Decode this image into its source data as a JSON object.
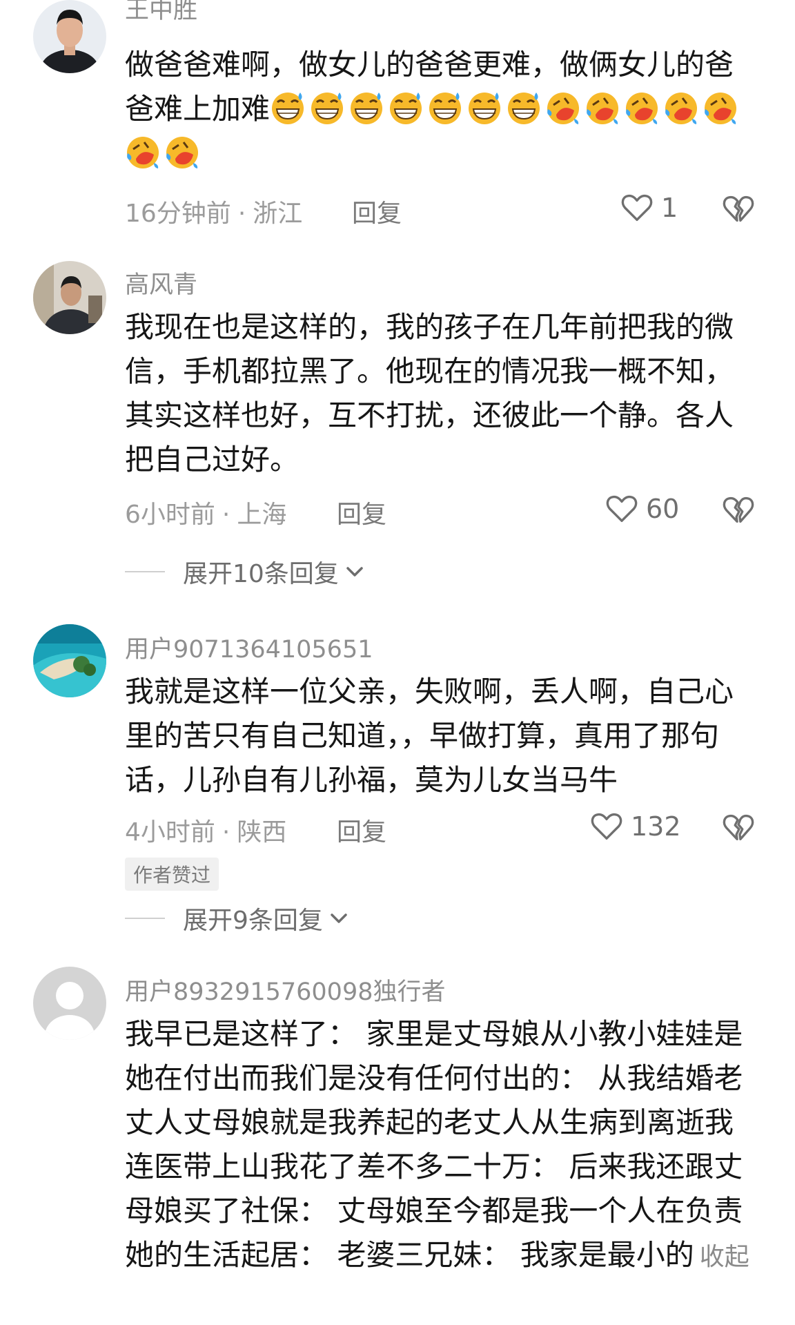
{
  "comments": [
    {
      "username": "王中胜",
      "text_1": "做爸爸难啊，做女儿的爸爸更难，做俩女儿的爸爸难上加难",
      "time": "16分钟前",
      "location": "浙江",
      "reply_label": "回复",
      "likes": "1"
    },
    {
      "username": "高风青",
      "text": "我现在也是这样的，我的孩子在几年前把我的微信，手机都拉黑了。他现在的情况我一概不知，其实这样也好，互不打扰，还彼此一个静。各人把自己过好。",
      "time": "6小时前",
      "location": "上海",
      "reply_label": "回复",
      "likes": "60",
      "expand_label": "展开10条回复"
    },
    {
      "username": "用户9071364105651",
      "text": "我就是这样一位父亲，失败啊，丢人啊，自己心里的苦只有自己知道，，早做打算，真用了那句话，儿孙自有儿孙福，莫为儿女当马牛",
      "time": "4小时前",
      "location": "陕西",
      "reply_label": "回复",
      "likes": "132",
      "badge": "作者赞过",
      "expand_label": "展开9条回复"
    },
    {
      "username": "用户8932915760098独行者",
      "text": "我早已是这样了： 家里是丈母娘从小教小娃娃是她在付出而我们是没有任何付出的： 从我结婚老丈人丈母娘就是我养起的老丈人从生病到离逝我连医带上山我花了差不多二十万： 后来我还跟丈母娘买了社保： 丈母娘至今都是我一个人在负责她的生活起居： 老婆三兄妹： 我家是最小的",
      "collapse_label": "收起"
    }
  ],
  "separator": "·",
  "icons": {
    "like": "heart-outline-icon",
    "dislike": "broken-heart-icon",
    "expand": "chevron-down-icon",
    "emoji_1": "grinning-sweat-emoji",
    "emoji_2": "rolling-laughing-emoji"
  },
  "colors": {
    "emoji_face": "#f7b92a",
    "emoji_mouth": "#e8432d",
    "emoji_tear": "#3fa7f0"
  }
}
